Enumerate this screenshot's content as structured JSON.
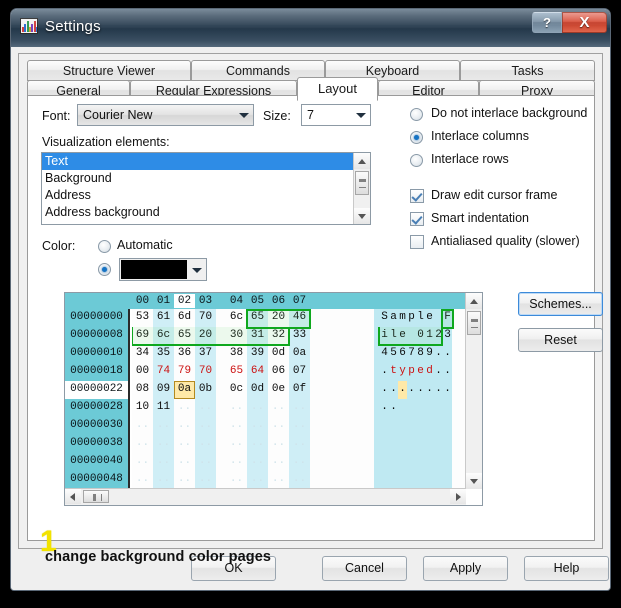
{
  "window": {
    "title": "Settings",
    "app_icon": "equalizer-icon",
    "help_button": "?",
    "close_button": "X"
  },
  "tabs": {
    "row1": [
      {
        "label": "Structure Viewer",
        "active": false
      },
      {
        "label": "Commands",
        "active": false
      },
      {
        "label": "Keyboard",
        "active": false
      },
      {
        "label": "Tasks",
        "active": false
      }
    ],
    "row2": [
      {
        "label": "General",
        "active": false
      },
      {
        "label": "Regular Expressions",
        "active": false
      },
      {
        "label": "Layout",
        "active": true
      },
      {
        "label": "Editor",
        "active": false
      },
      {
        "label": "Proxy",
        "active": false
      }
    ]
  },
  "layout_page": {
    "font_label": "Font:",
    "font_value": "Courier New",
    "size_label": "Size:",
    "size_value": "7",
    "viz_label": "Visualization elements:",
    "viz_items": [
      {
        "label": "Text",
        "selected": true
      },
      {
        "label": "Background",
        "selected": false
      },
      {
        "label": "Address",
        "selected": false
      },
      {
        "label": "Address background",
        "selected": false
      }
    ],
    "color_label": "Color:",
    "color_automatic_label": "Automatic",
    "color_automatic_selected": false,
    "color_custom_selected": true,
    "color_custom_value": "#000000",
    "interlace_options": [
      {
        "label": "Do not interlace background",
        "selected": false
      },
      {
        "label": "Interlace columns",
        "selected": true
      },
      {
        "label": "Interlace rows",
        "selected": false
      }
    ],
    "checkbox_options": [
      {
        "label": "Draw edit cursor frame",
        "checked": true
      },
      {
        "label": "Smart indentation",
        "checked": true
      },
      {
        "label": "Antialiased quality (slower)",
        "checked": false
      }
    ],
    "schemes_button": "Schemes...",
    "reset_button": "Reset"
  },
  "hex_preview": {
    "column_headers": [
      "00",
      "01",
      "02",
      "03",
      "04",
      "05",
      "06",
      "07"
    ],
    "highlighted_column": "02",
    "highlighted_row_address": "00000022",
    "cursor_cell": "0a",
    "rows": [
      {
        "address": "00000000",
        "bytes": [
          "53",
          "61",
          "6d",
          "70",
          "6c",
          "65",
          "20",
          "46"
        ],
        "byte_colors": [
          "black",
          "black",
          "black",
          "black",
          "black",
          "black",
          "black",
          "black"
        ],
        "ascii": "Sample F"
      },
      {
        "address": "00000008",
        "bytes": [
          "69",
          "6c",
          "65",
          "20",
          "30",
          "31",
          "32",
          "33"
        ],
        "byte_colors": [
          "black",
          "black",
          "black",
          "black",
          "black",
          "black",
          "black",
          "black"
        ],
        "ascii": "ile 0123"
      },
      {
        "address": "00000010",
        "bytes": [
          "34",
          "35",
          "36",
          "37",
          "38",
          "39",
          "0d",
          "0a"
        ],
        "byte_colors": [
          "black",
          "black",
          "black",
          "black",
          "black",
          "black",
          "black",
          "black"
        ],
        "ascii": "456789.."
      },
      {
        "address": "00000018",
        "bytes": [
          "00",
          "74",
          "79",
          "70",
          "65",
          "64",
          "06",
          "07"
        ],
        "byte_colors": [
          "black",
          "red",
          "red",
          "red",
          "red",
          "red",
          "black",
          "black"
        ],
        "ascii": ".typed..",
        "ascii_colors": [
          "black",
          "red",
          "red",
          "red",
          "red",
          "red",
          "black",
          "black"
        ]
      },
      {
        "address": "00000022",
        "bytes": [
          "08",
          "09",
          "0a",
          "0b",
          "0c",
          "0d",
          "0e",
          "0f"
        ],
        "byte_colors": [
          "black",
          "black",
          "black",
          "black",
          "black",
          "black",
          "black",
          "black"
        ],
        "ascii": "........"
      },
      {
        "address": "00000028",
        "bytes": [
          "10",
          "11",
          "..",
          "..",
          "..",
          "..",
          "..",
          ".."
        ],
        "byte_colors": [
          "black",
          "black",
          "dim",
          "dim",
          "dim",
          "dim",
          "dim",
          "dim"
        ],
        "ascii": "........"
      },
      {
        "address": "00000030",
        "bytes": [
          "..",
          "..",
          "..",
          "..",
          "..",
          "..",
          "..",
          ".."
        ],
        "byte_colors": [
          "dim",
          "dim",
          "dim",
          "dim",
          "dim",
          "dim",
          "dim",
          "dim"
        ],
        "ascii": "........"
      },
      {
        "address": "00000038",
        "bytes": [
          "..",
          "..",
          "..",
          "..",
          "..",
          "..",
          "..",
          ".."
        ],
        "byte_colors": [
          "dim",
          "dim",
          "dim",
          "dim",
          "dim",
          "dim",
          "dim",
          "dim"
        ],
        "ascii": "........"
      },
      {
        "address": "00000040",
        "bytes": [
          "..",
          "..",
          "..",
          "..",
          "..",
          "..",
          "..",
          ".."
        ],
        "byte_colors": [
          "dim",
          "dim",
          "dim",
          "dim",
          "dim",
          "dim",
          "dim",
          "dim"
        ],
        "ascii": "........"
      },
      {
        "address": "00000048",
        "bytes": [
          "..",
          "..",
          "..",
          "..",
          "..",
          "..",
          "..",
          ".."
        ],
        "byte_colors": [
          "dim",
          "dim",
          "dim",
          "dim",
          "dim",
          "dim",
          "dim",
          "dim"
        ],
        "ascii": "........"
      }
    ]
  },
  "footer": {
    "ok": "OK",
    "cancel": "Cancel",
    "apply": "Apply",
    "help": "Help"
  },
  "annotation": {
    "marker": "1",
    "text": "change background color pages"
  },
  "colors": {
    "accent_blue": "#2e8ce6",
    "address_teal": "#6ccad6",
    "ascii_band": "#bfe9f2",
    "interlace_band": "#cfeef6",
    "selection_green": "#0fa81e",
    "cursor_yellow": "#ffe9a8",
    "byte_red": "#cc1111",
    "annotation_yellow": "#f2e300"
  }
}
